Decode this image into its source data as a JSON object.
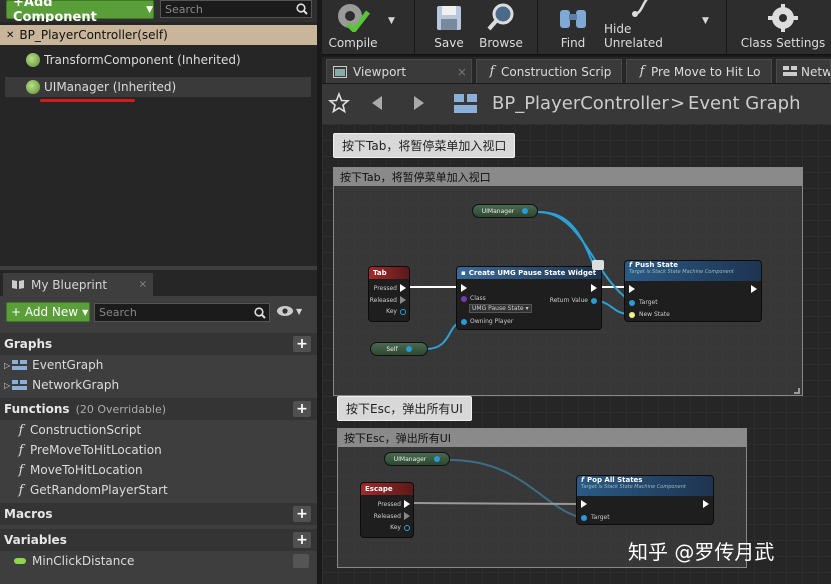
{
  "components": {
    "add_label": "+Add Component",
    "search_placeholder": "Search",
    "items": [
      {
        "label": "BP_PlayerController(self)"
      },
      {
        "label": "TransformComponent (Inherited)"
      },
      {
        "label": "UIManager (Inherited)"
      }
    ]
  },
  "my_blueprint": {
    "tab_label": "My Blueprint",
    "add_new_label": "+ Add New",
    "search_placeholder": "Search",
    "graphs_header": "Graphs",
    "graphs": [
      "EventGraph",
      "NetworkGraph"
    ],
    "functions_header": "Functions",
    "functions_overridable": "(20 Overridable)",
    "functions": [
      "ConstructionScript",
      "PreMoveToHitLocation",
      "MoveToHitLocation",
      "GetRandomPlayerStart"
    ],
    "macros_header": "Macros",
    "variables_header": "Variables",
    "variables": [
      "MinClickDistance"
    ]
  },
  "toolbar": {
    "compile": "Compile",
    "save": "Save",
    "browse": "Browse",
    "find": "Find",
    "hide_unrelated": "Hide Unrelated",
    "class_settings": "Class Settings"
  },
  "tabs": [
    "Viewport",
    "Construction Scrip",
    "Pre Move to Hit Lo",
    "Netw"
  ],
  "breadcrumb": {
    "blueprint": "BP_PlayerController",
    "separator": ">",
    "graph": "Event Graph"
  },
  "graph": {
    "comment1": {
      "bubble": "按下Tab，将暂停菜单加入视口",
      "title": "按下Tab，将暂停菜单加入视口"
    },
    "comment2": {
      "bubble": "按下Esc，弹出所有UI",
      "title": "按下Esc，弹出所有UI"
    },
    "uimanager_label": "UIManager",
    "self_label": "Self",
    "tab_node": {
      "title": "Tab",
      "pressed": "Pressed",
      "released": "Released",
      "key": "Key"
    },
    "create_widget": {
      "title": "Create UMG Pause State Widget",
      "class": "Class",
      "class_value": "UMG Pause State",
      "return_value": "Return Value",
      "owning_player": "Owning Player"
    },
    "push_state": {
      "title": "Push State",
      "subtitle": "Target is Stack State Machine Component",
      "target": "Target",
      "new_state": "New State"
    },
    "escape_node": {
      "title": "Escape",
      "pressed": "Pressed",
      "released": "Released",
      "key": "Key"
    },
    "pop_all": {
      "title": "Pop All States",
      "subtitle": "Target is Stack State Machine Component",
      "target": "Target"
    }
  },
  "watermark": "知乎 @罗传月武"
}
